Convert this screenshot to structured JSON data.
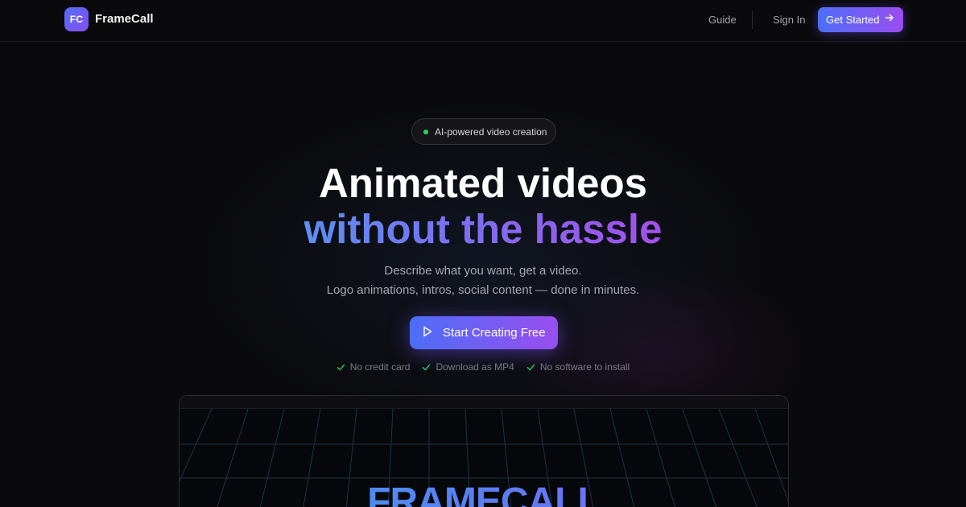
{
  "brand": {
    "badge": "FC",
    "name": "FrameCall",
    "gradient_start": "#4f6ff5",
    "gradient_end": "#8b4df0"
  },
  "nav": {
    "guide": "Guide",
    "sign_in": "Sign In",
    "cta": "Get Started",
    "cta_icon": "arrow-right-icon"
  },
  "hero": {
    "pill": "AI-powered video creation",
    "pill_dot_color": "#2fd35e",
    "headline_line1": "Animated videos",
    "headline_line2": "without the hassle",
    "subline1": "Describe what you want, get a video.",
    "subline2": "Logo animations, intros, social content — done in minutes.",
    "cta": "Start Creating Free",
    "cta_icon": "play-icon",
    "checks": [
      "No credit card",
      "Download as MP4",
      "No software to install"
    ],
    "check_color": "#2fbf5a"
  },
  "preview": {
    "title": "FRAMECALL"
  }
}
